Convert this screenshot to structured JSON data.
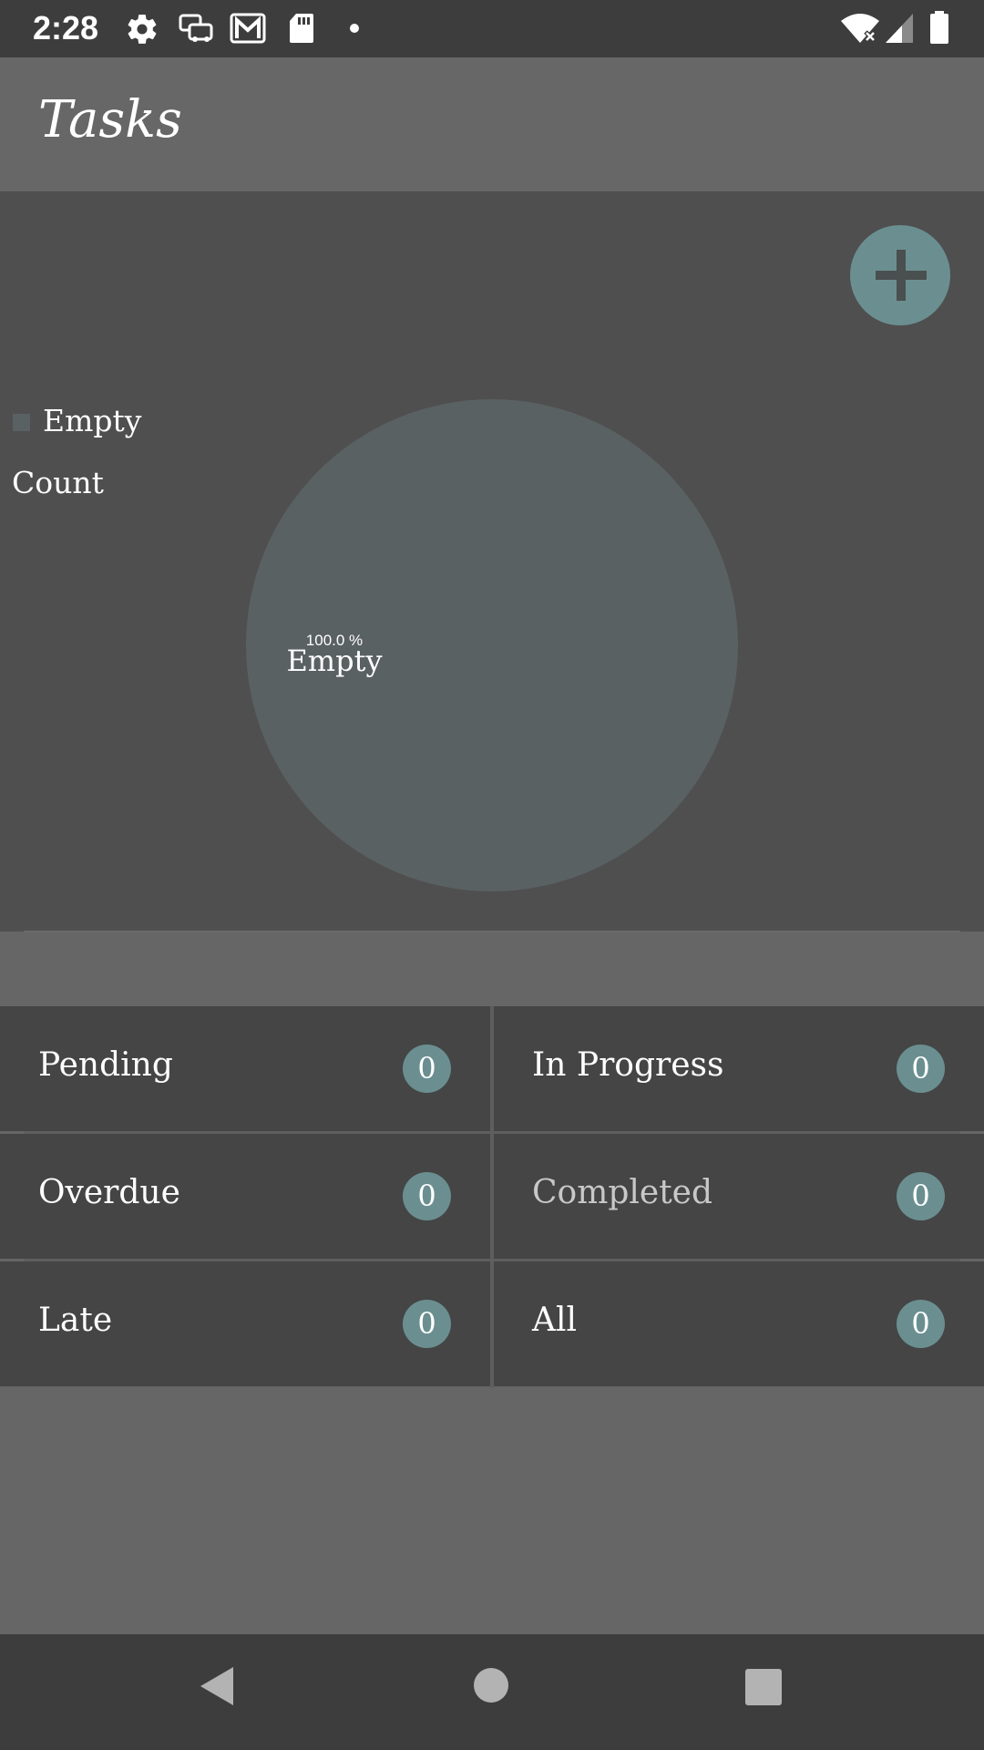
{
  "status_bar": {
    "time": "2:28"
  },
  "app_bar": {
    "title": "Tasks"
  },
  "chart_data": {
    "type": "pie",
    "categories": [
      "Empty"
    ],
    "values": [
      100.0
    ],
    "slice_labels": [
      "Empty"
    ],
    "value_labels": [
      "100.0 %"
    ],
    "legend": [
      "Empty"
    ],
    "legend_placement": "top-left",
    "description_label": "Count",
    "colors": [
      "#5a6162"
    ]
  },
  "status_cells": [
    {
      "label": "Pending",
      "count": "0"
    },
    {
      "label": "In Progress",
      "count": "0"
    },
    {
      "label": "Overdue",
      "count": "0"
    },
    {
      "label": "Completed",
      "count": "0"
    },
    {
      "label": "Late",
      "count": "0"
    },
    {
      "label": "All",
      "count": "0"
    }
  ],
  "colors": {
    "accent": "#6b8f90",
    "panel": "#4f4f4f",
    "cell": "#454545",
    "bars": "#3d3d3d"
  },
  "icons": {
    "status_bar": [
      "settings-icon",
      "car-notification-icon",
      "gmail-icon",
      "sd-card-icon",
      "notification-dot-icon",
      "wifi-off-icon",
      "signal-icon",
      "battery-icon"
    ],
    "fab": "plus-icon",
    "nav": [
      "back-icon",
      "home-icon",
      "recents-icon"
    ]
  }
}
